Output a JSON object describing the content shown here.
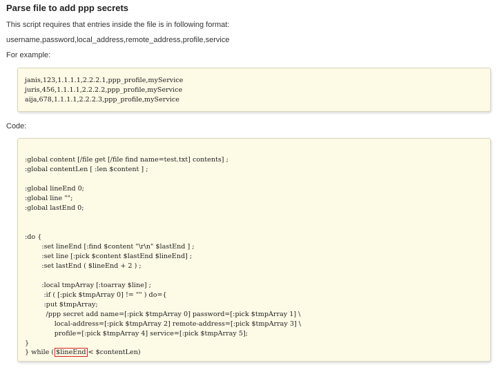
{
  "heading": "Parse file to add ppp secrets",
  "intro": "This script requires that entries inside the file is in following format:",
  "format_line": "username,password,local_address,remote_address,profile,service",
  "example_label": "For example:",
  "example_lines": [
    "janis,123,1.1.1.1,2.2.2.1,ppp_profile,myService",
    "juris,456,1.1.1.1,2.2.2.2,ppp_profile,myService",
    "aija,678,1.1.1.1,2.2.2.3,ppp_profile,myService"
  ],
  "code_label": "Code:",
  "code_lines": [
    ":global content [/file get [/file find name=test.txt] contents] ;",
    ":global contentLen [ :len $content ] ;",
    "",
    ":global lineEnd 0;",
    ":global line \"\";",
    ":global lastEnd 0;",
    "",
    "",
    ":do {",
    "        :set lineEnd [:find $content \"\\r\\n\" $lastEnd ] ;",
    "        :set line [:pick $content $lastEnd $lineEnd] ;",
    "        :set lastEnd ( $lineEnd + 2 ) ;",
    "",
    "        :local tmpArray [:toarray $line] ;",
    "         :if ( [:pick $tmpArray 0] != \"\" ) do={",
    "         :put $tmpArray;",
    "          /ppp secret add name=[:pick $tmpArray 0] password=[:pick $tmpArray 1] \\",
    "              local-address=[:pick $tmpArray 2] remote-address=[:pick $tmpArray 3] \\",
    "              profile=[:pick $tmpArray 4] service=[:pick $tmpArray 5];",
    "}"
  ],
  "last_line": {
    "before": "} while (",
    "highlight": "$lineEnd",
    "after": "< $contentLen)"
  }
}
